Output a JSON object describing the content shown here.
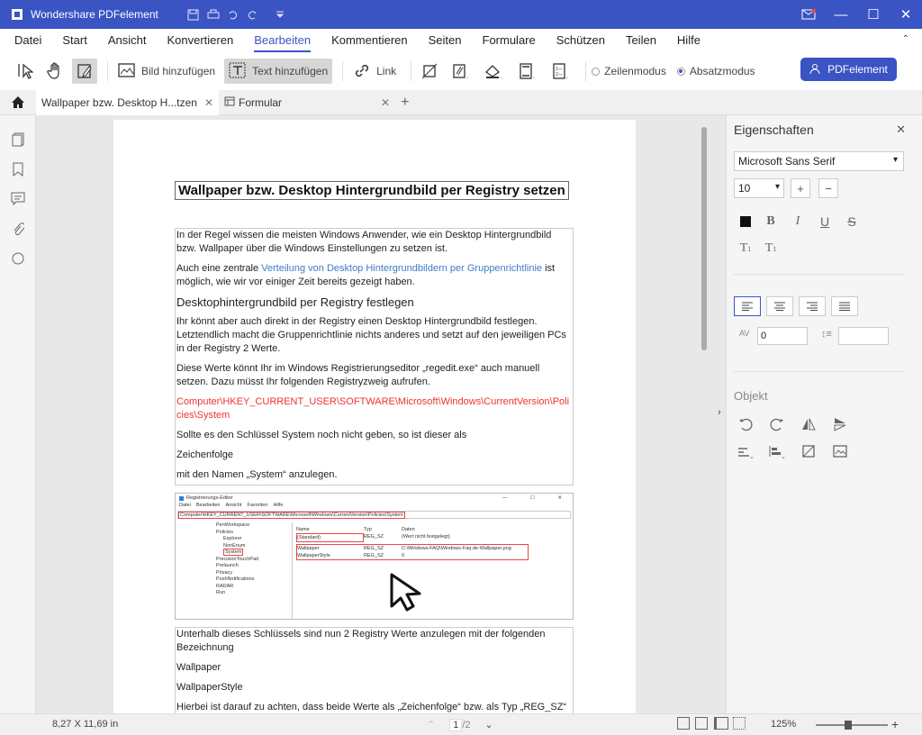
{
  "app": {
    "title": "Wondershare PDFelement"
  },
  "menu": {
    "items": [
      "Datei",
      "Start",
      "Ansicht",
      "Konvertieren",
      "Bearbeiten",
      "Kommentieren",
      "Seiten",
      "Formulare",
      "Schützen",
      "Teilen",
      "Hilfe"
    ],
    "active": "Bearbeiten"
  },
  "toolbar": {
    "add_image_label": "Bild hinzufügen",
    "add_text_label": "Text hinzufügen",
    "link_label": "Link",
    "mode_line": "Zeilenmodus",
    "mode_paragraph": "Absatzmodus",
    "account_button": "PDFelement"
  },
  "tabs": [
    {
      "label": "Wallpaper bzw. Desktop H...tzen",
      "active": true
    },
    {
      "label": "Formular",
      "active": false
    }
  ],
  "document": {
    "title": "Wallpaper bzw. Desktop Hintergrundbild per Registry setzen",
    "p1": "In der Regel wissen die meisten Windows Anwender, wie ein Desktop Hintergrundbild bzw. Wallpaper über die Windows Einstellungen zu setzen ist.",
    "p2_pre": "Auch eine zentrale ",
    "p2_link": "Verteilung von Desktop Hintergrundbildern per Gruppenrichtlinie",
    "p2_post": " ist möglich, wie wir vor einiger Zeit bereits gezeigt haben.",
    "h2": "Desktophintergrundbild per Registry festlegen",
    "p3": "Ihr könnt aber auch direkt in der Registry einen Desktop Hintergrundbild festlegen. Letztendlich macht die Gruppenrichtlinie nichts anderes und setzt auf den jeweiligen PCs in der Registry 2 Werte.",
    "p4": "Diese Werte könnt Ihr im Windows Registrierungseditor „regedit.exe“ auch manuell setzen. Dazu müsst Ihr folgenden Registryzweig aufrufen.",
    "reg_path": "Computer\\HKEY_CURRENT_USER\\SOFTWARE\\Microsoft\\Windows\\CurrentVersion\\Policies\\System",
    "p5": "Sollte es den Schlüssel System noch nicht geben, so ist dieser als",
    "p6": "Zeichenfolge",
    "p7": "mit den Namen „System“ anzulegen.",
    "p8": "Unterhalb dieses Schlüssels sind nun 2 Registry Werte anzulegen mit der folgenden Bezeichnung",
    "p9": "Wallpaper",
    "p10": "WallpaperStyle",
    "p11": "Hierbei ist darauf zu achten, dass beide Werte als „Zeichenfolge“ bzw. als Typ „REG_SZ“ anzulegen sind. Am besten Ihr schaut auf die obige Abbildung und legt die Werte genauso an wie"
  },
  "screenshot": {
    "title": "Registrierungs-Editor",
    "menu": [
      "Datei",
      "Bearbeiten",
      "Ansicht",
      "Favoriten",
      "Hilfe"
    ],
    "path": "Computer\\HKEY_CURRENT_USER\\SOFTWARE\\Microsoft\\Windows\\CurrentVersion\\Policies\\System",
    "tree": [
      "PenWorkspace",
      "Policies",
      "Explorer",
      "NonEnum",
      "System",
      "PrecisionTouchPad",
      "Prelaunch",
      "Privacy",
      "PushNotifications",
      "RADAR",
      "Run"
    ],
    "columns": [
      "Name",
      "Typ",
      "Daten"
    ],
    "rows": [
      [
        "(Standard)",
        "REG_SZ",
        "(Wert nicht festgelegt)"
      ],
      [
        "Wallpaper",
        "REG_SZ",
        "C:\\Windows-FAQ\\Windows-Faq.de-Wallpaper.png"
      ],
      [
        "WallpaperStyle",
        "REG_SZ",
        "0"
      ]
    ]
  },
  "properties": {
    "title": "Eigenschaften",
    "font": "Microsoft Sans Serif",
    "size": "10",
    "char_spacing": "0",
    "line_spacing": "",
    "object_title": "Objekt"
  },
  "status": {
    "dims": "8,27 X 11,69 in",
    "page": "1",
    "page_total": "/2",
    "zoom": "125%"
  }
}
